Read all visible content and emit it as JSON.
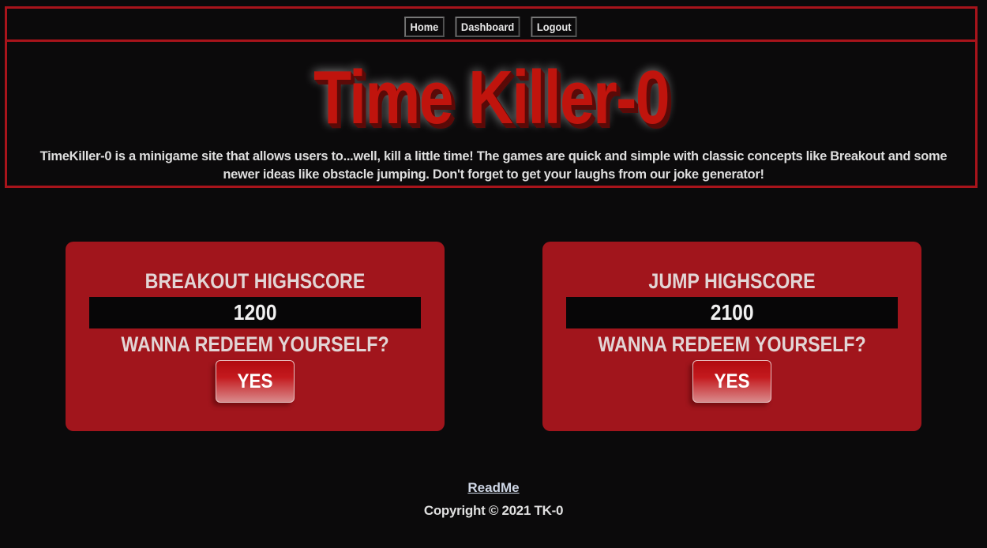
{
  "nav": {
    "items": [
      {
        "label": "Home"
      },
      {
        "label": "Dashboard"
      },
      {
        "label": "Logout"
      }
    ]
  },
  "header": {
    "title": "Time Killer-0",
    "intro": "TimeKiller-0 is a minigame site that allows users to...well, kill a little time! The games are quick and simple with classic concepts like Breakout and some newer ideas like obstacle jumping. Don't forget to get your laughs from our joke generator!"
  },
  "cards": [
    {
      "title": "BREAKOUT HIGHSCORE",
      "score": "1200",
      "question": "WANNA REDEEM YOURSELF?",
      "button_label": "YES"
    },
    {
      "title": "JUMP HIGHSCORE",
      "score": "2100",
      "question": "WANNA REDEEM YOURSELF?",
      "button_label": "YES"
    }
  ],
  "footer": {
    "readme_label": "ReadMe",
    "copyright": "Copyright © 2021 TK-0"
  },
  "colors": {
    "background": "#0b0a0b",
    "accent_red": "#a8141b",
    "card_red": "#a1151c",
    "title_red": "#c0140d"
  }
}
